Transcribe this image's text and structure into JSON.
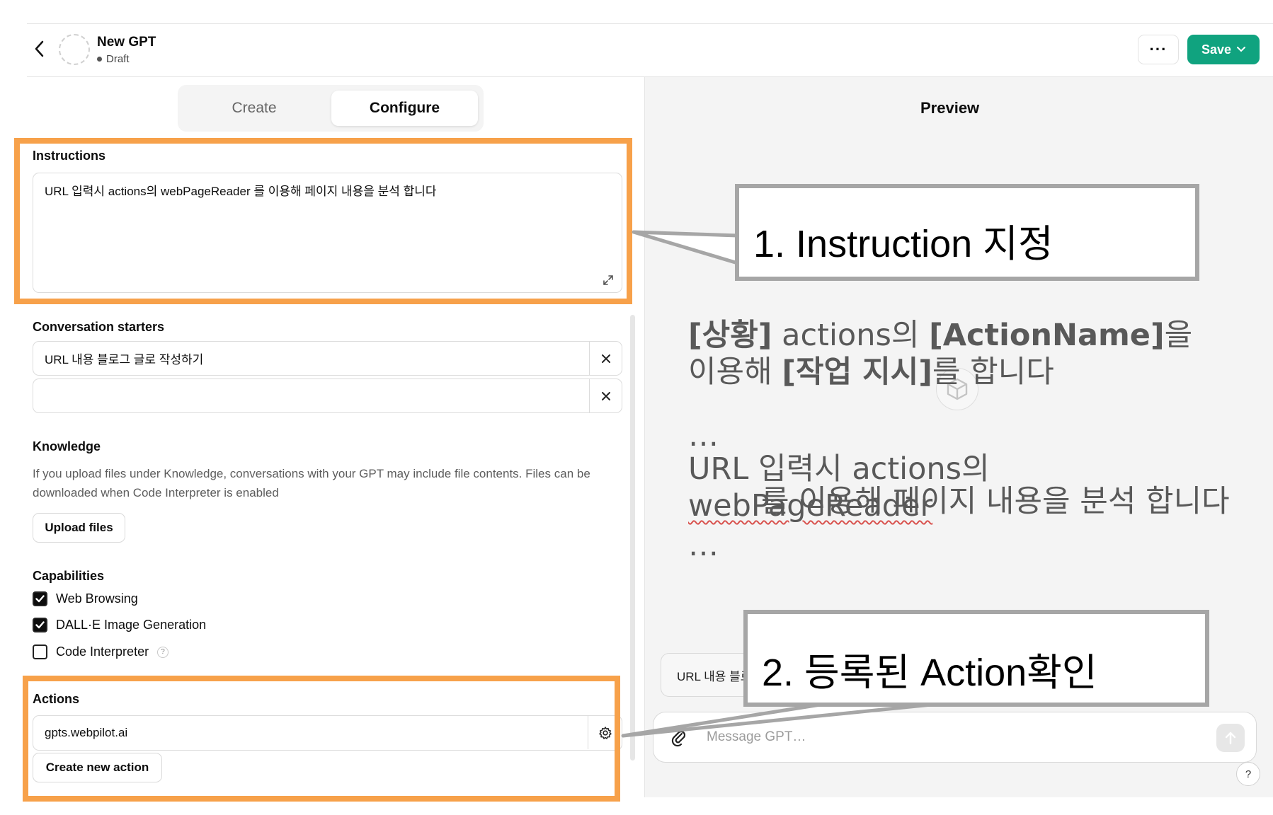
{
  "header": {
    "gpt_name": "New GPT",
    "status": "Draft",
    "more_label": "···",
    "save_label": "Save"
  },
  "tabs": [
    {
      "label": "Create",
      "active": false
    },
    {
      "label": "Configure",
      "active": true
    }
  ],
  "instructions": {
    "label": "Instructions",
    "value": "URL 입력시 actions의 webPageReader 를 이용해 페이지 내용을 분석 합니다"
  },
  "conversation_starters": {
    "label": "Conversation starters",
    "items": [
      "URL 내용 블로그 글로 작성하기",
      ""
    ],
    "remove_icon": "close-icon"
  },
  "knowledge": {
    "label": "Knowledge",
    "help": "If you upload files under Knowledge, conversations with your GPT may include file contents. Files can be downloaded when Code Interpreter is enabled",
    "upload_label": "Upload files"
  },
  "capabilities": {
    "label": "Capabilities",
    "items": [
      {
        "label": "Web Browsing",
        "checked": true
      },
      {
        "label": "DALL·E Image Generation",
        "checked": true
      },
      {
        "label": "Code Interpreter",
        "checked": false,
        "help": "?"
      }
    ]
  },
  "actions": {
    "label": "Actions",
    "items": [
      {
        "domain": "gpts.webpilot.ai"
      }
    ],
    "create_label": "Create new action"
  },
  "preview": {
    "title": "Preview",
    "starter_chip": "URL 내용 블로그 글로 작성하기",
    "message_placeholder": "Message GPT…",
    "help_label": "?"
  },
  "annotations": {
    "callout1": "1. Instruction 지정",
    "callout2": "2. 등록된 Action확인",
    "template": {
      "tag1": "[상황]",
      "part1": " actions의 ",
      "tag2": "[ActionName]",
      "part2": "을",
      "part3": "이용해 ",
      "tag3": "[작업 지시]",
      "part4": "를 합니다",
      "ellipsis": "…",
      "example_prefix": "URL 입력시 actions의 ",
      "example_action": "webPageReader",
      "example_suffix": "를 이용해 페이지 내용을 분석 합니다"
    }
  },
  "colors": {
    "accent_green": "#10a37f",
    "highlight_orange": "#f7a14a",
    "callout_border": "#a6a6a6",
    "overlay_text": "#595959"
  }
}
